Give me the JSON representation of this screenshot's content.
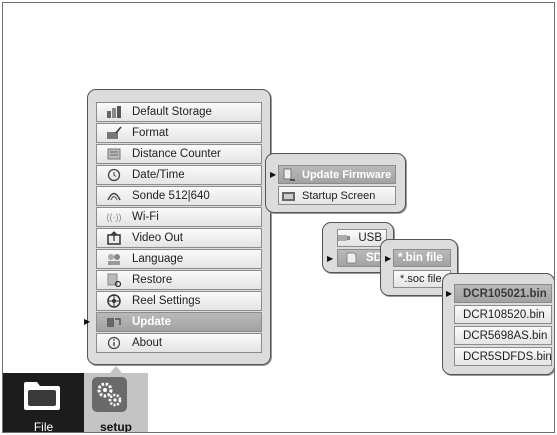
{
  "setup_menu": {
    "items": [
      {
        "label": "Default Storage",
        "icon": "storage-icon"
      },
      {
        "label": "Format",
        "icon": "format-icon"
      },
      {
        "label": "Distance Counter",
        "icon": "counter-icon"
      },
      {
        "label": "Date/Time",
        "icon": "clock-icon"
      },
      {
        "label": "Sonde 512|640",
        "icon": "sonde-icon"
      },
      {
        "label": "Wi-Fi",
        "icon": "wifi-icon"
      },
      {
        "label": "Video Out",
        "icon": "video-out-icon"
      },
      {
        "label": "Language",
        "icon": "language-icon"
      },
      {
        "label": "Restore",
        "icon": "restore-icon"
      },
      {
        "label": "Reel Settings",
        "icon": "reel-icon"
      },
      {
        "label": "Update",
        "icon": "update-icon",
        "selected": true
      },
      {
        "label": "About",
        "icon": "info-icon"
      }
    ]
  },
  "update_menu": {
    "items": [
      {
        "label": "Update Firmware",
        "icon": "firmware-icon",
        "selected": true
      },
      {
        "label": "Startup Screen",
        "icon": "startup-icon"
      }
    ]
  },
  "source_menu": {
    "items": [
      {
        "label": "USB",
        "icon": "usb-icon"
      },
      {
        "label": "SD",
        "icon": "sd-card-icon",
        "selected": true
      }
    ]
  },
  "filetype_menu": {
    "items": [
      {
        "label": "*.bin file",
        "selected": true
      },
      {
        "label": "*.soc file"
      }
    ]
  },
  "files_menu": {
    "items": [
      {
        "label": "DCR105021.bin",
        "selected": true
      },
      {
        "label": "DCR108520.bin"
      },
      {
        "label": "DCR5698AS.bin"
      },
      {
        "label": "DCR5SDFDS.bin"
      }
    ]
  },
  "taskbar": {
    "file_label": "File",
    "setup_label": "setup",
    "file_icon": "folder-icon",
    "setup_icon": "gears-icon",
    "active": "setup"
  },
  "colors": {
    "panel_bg": "#dcdcdc",
    "selected_bg": "#a8a8a8",
    "taskbar_file_bg": "#1c1c1c",
    "taskbar_setup_bg": "#c4c4c4"
  }
}
